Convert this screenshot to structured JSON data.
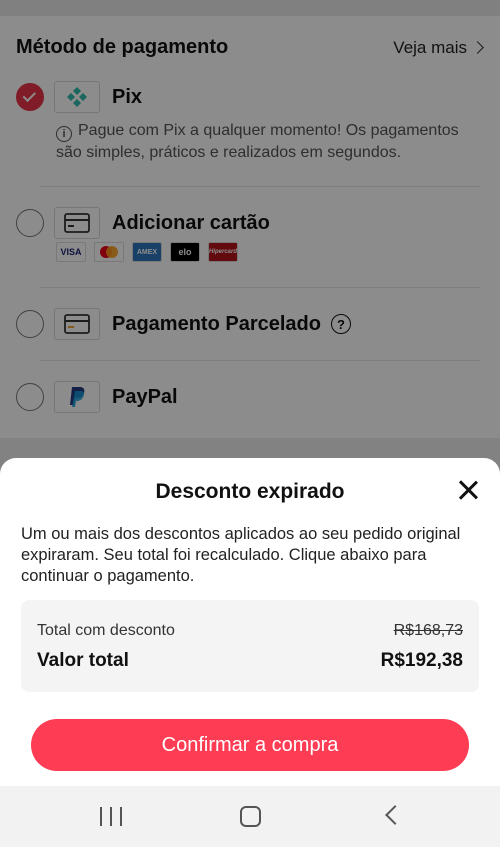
{
  "payment": {
    "title": "Método de pagamento",
    "see_more": "Veja mais",
    "methods": [
      {
        "label": "Pix",
        "selected": true
      },
      {
        "label": "Adicionar cartão",
        "selected": false
      },
      {
        "label": "Pagamento Parcelado",
        "selected": false
      },
      {
        "label": "PayPal",
        "selected": false
      }
    ],
    "pix_note": "Pague com Pix a qualquer momento! Os pagamentos são simples, práticos e realizados em segundos.",
    "card_brands": [
      "VISA",
      "mastercard",
      "AMEX",
      "elo",
      "Hipercard"
    ]
  },
  "modal": {
    "title": "Desconto expirado",
    "message": "Um ou mais dos descontos aplicados ao seu pedido original expiraram. Seu total foi recalculado. Clique abaixo para continuar o pagamento.",
    "discount_label": "Total com desconto",
    "discount_value": "R$168,73",
    "total_label": "Valor total",
    "total_value": "R$192,38",
    "confirm_label": "Confirmar a compra"
  },
  "colors": {
    "accent": "#fe3c54",
    "pix": "#32bcad",
    "paypal": "#253b80"
  }
}
